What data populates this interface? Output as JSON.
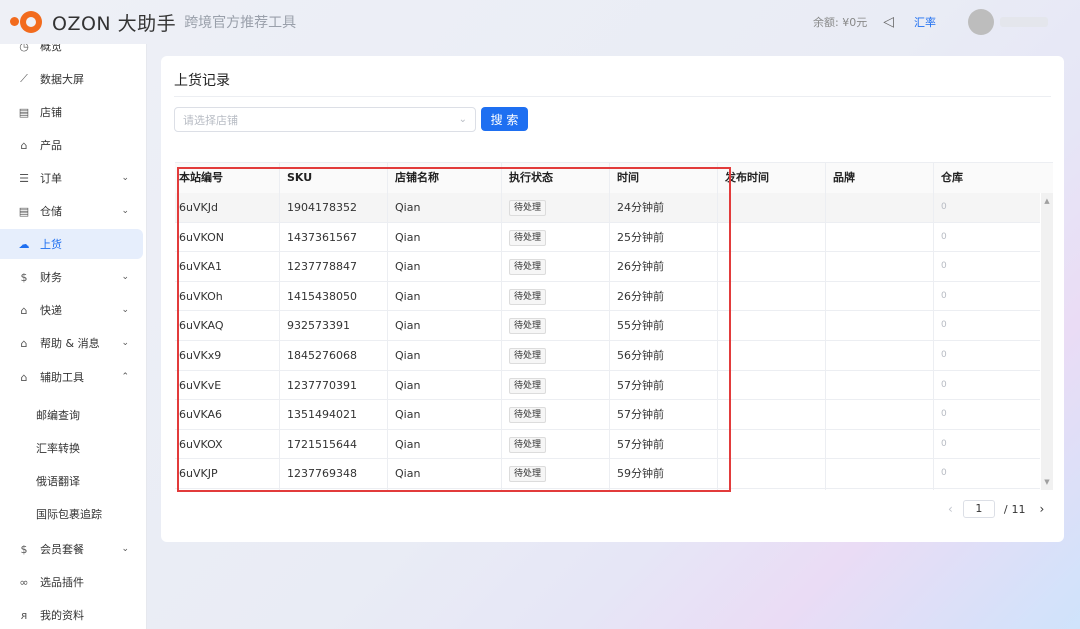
{
  "header": {
    "brand": "OZON 大助手",
    "subtitle": "跨境官方推荐工具",
    "balance": "余额: ¥0元",
    "rate_link": "汇率"
  },
  "sidebar": {
    "items": [
      {
        "label": "概览",
        "icon": "clock-icon"
      },
      {
        "label": "数据大屏",
        "icon": "chart-icon"
      },
      {
        "label": "店铺",
        "icon": "store-icon"
      },
      {
        "label": "产品",
        "icon": "bag-icon"
      },
      {
        "label": "订单",
        "icon": "list-icon"
      },
      {
        "label": "仓储",
        "icon": "warehouse-icon"
      },
      {
        "label": "上货",
        "icon": "cloud-upload-icon"
      },
      {
        "label": "财务",
        "icon": "dollar-icon"
      },
      {
        "label": "快递",
        "icon": "bag-icon"
      },
      {
        "label": "帮助 & 消息",
        "icon": "bag-icon"
      },
      {
        "label": "辅助工具",
        "icon": "bag-icon"
      }
    ],
    "sub_items": [
      "邮编查询",
      "汇率转换",
      "俄语翻译",
      "国际包裹追踪"
    ],
    "bottom_items": [
      {
        "label": "会员套餐",
        "icon": "dollar-icon"
      },
      {
        "label": "选品插件",
        "icon": "link-icon"
      },
      {
        "label": "我的资料",
        "icon": "user-icon"
      }
    ]
  },
  "main": {
    "title": "上货记录",
    "shop_select_placeholder": "请选择店铺",
    "search_button": "搜 索",
    "columns": [
      "本站编号",
      "SKU",
      "店铺名称",
      "执行状态",
      "时间",
      "发布时间",
      "品牌",
      "仓库"
    ],
    "rows": [
      {
        "id": "6uVKJd",
        "sku": "1904178352",
        "shop": "Qian",
        "status": "待处理",
        "time": "24分钟前",
        "warehouse": "0"
      },
      {
        "id": "6uVKON",
        "sku": "1437361567",
        "shop": "Qian",
        "status": "待处理",
        "time": "25分钟前",
        "warehouse": "0"
      },
      {
        "id": "6uVKA1",
        "sku": "1237778847",
        "shop": "Qian",
        "status": "待处理",
        "time": "26分钟前",
        "warehouse": "0"
      },
      {
        "id": "6uVKOh",
        "sku": "1415438050",
        "shop": "Qian",
        "status": "待处理",
        "time": "26分钟前",
        "warehouse": "0"
      },
      {
        "id": "6uVKAQ",
        "sku": "932573391",
        "shop": "Qian",
        "status": "待处理",
        "time": "55分钟前",
        "warehouse": "0"
      },
      {
        "id": "6uVKx9",
        "sku": "1845276068",
        "shop": "Qian",
        "status": "待处理",
        "time": "56分钟前",
        "warehouse": "0"
      },
      {
        "id": "6uVKvE",
        "sku": "1237770391",
        "shop": "Qian",
        "status": "待处理",
        "time": "57分钟前",
        "warehouse": "0"
      },
      {
        "id": "6uVKA6",
        "sku": "1351494021",
        "shop": "Qian",
        "status": "待处理",
        "time": "57分钟前",
        "warehouse": "0"
      },
      {
        "id": "6uVKOX",
        "sku": "1721515644",
        "shop": "Qian",
        "status": "待处理",
        "time": "57分钟前",
        "warehouse": "0"
      },
      {
        "id": "6uVKJP",
        "sku": "1237769348",
        "shop": "Qian",
        "status": "待处理",
        "time": "59分钟前",
        "warehouse": "0"
      }
    ]
  },
  "pagination": {
    "current": "1",
    "separator": "/",
    "total": "11"
  }
}
